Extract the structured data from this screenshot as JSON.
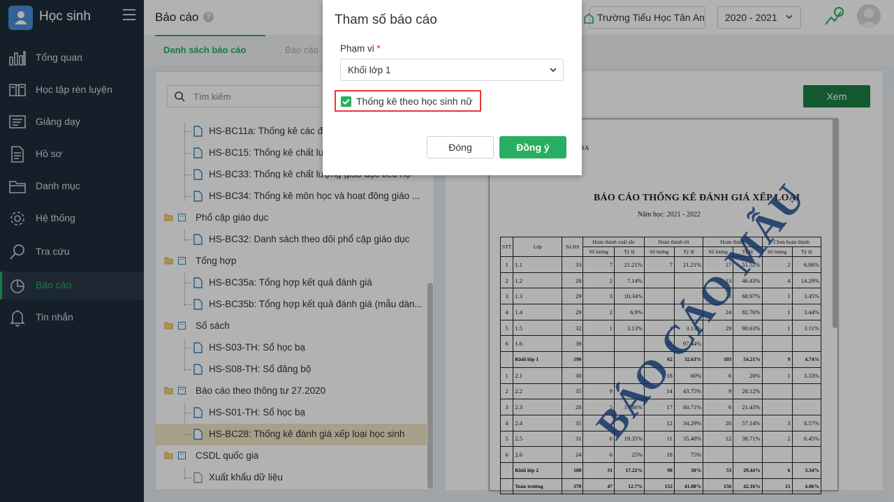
{
  "app": {
    "title": "Học sinh"
  },
  "sidebar": {
    "items": [
      {
        "label": "Tổng quan",
        "icon": "bar-chart-icon"
      },
      {
        "label": "Học tập rèn luyện",
        "icon": "book-icon"
      },
      {
        "label": "Giảng dạy",
        "icon": "board-icon"
      },
      {
        "label": "Hồ sơ",
        "icon": "document-icon"
      },
      {
        "label": "Danh mục",
        "icon": "folder-icon"
      },
      {
        "label": "Hệ thống",
        "icon": "gear-icon"
      },
      {
        "label": "Tra cứu",
        "icon": "search-icon"
      },
      {
        "label": "Báo cáo",
        "icon": "pie-chart-icon",
        "active": true
      },
      {
        "label": "Tin nhắn",
        "icon": "bell-icon"
      }
    ]
  },
  "header": {
    "page_title": "Báo cáo",
    "help": "?",
    "school": "Trường Tiểu Học Tân An",
    "year": "2020 - 2021"
  },
  "tabs": {
    "list": "Danh sách báo cáo",
    "other": "Báo cáo"
  },
  "search": {
    "placeholder": "Tìm kiếm"
  },
  "tree": [
    {
      "type": "file",
      "label": "HS-BC11a: Thống kê các đố"
    },
    {
      "type": "file",
      "label": "HS-BC15: Thống kê chất lượ"
    },
    {
      "type": "file",
      "label": "HS-BC33: Thống kê chất lượng giáo dục tiểu học"
    },
    {
      "type": "file",
      "label": "HS-BC34: Thống kê môn học và hoạt động giáo ..."
    },
    {
      "type": "folder",
      "label": "Phổ cập giáo dục"
    },
    {
      "type": "file",
      "label": "HS-BC32: Danh sách theo dõi phổ cập giáo dục"
    },
    {
      "type": "folder",
      "label": "Tổng hợp"
    },
    {
      "type": "file",
      "label": "HS-BC35a: Tổng hợp kết quả đánh giá"
    },
    {
      "type": "file",
      "label": "HS-BC35b: Tổng hợp kết quả đánh giá (mẫu dàn..."
    },
    {
      "type": "folder",
      "label": "Sổ sách"
    },
    {
      "type": "file",
      "label": "HS-S03-TH: Sổ học bạ"
    },
    {
      "type": "file",
      "label": "HS-S08-TH: Sổ đăng bộ"
    },
    {
      "type": "folder",
      "label": "Báo cáo theo thông tư 27.2020"
    },
    {
      "type": "file",
      "label": "HS-S01-TH: Sổ học bạ"
    },
    {
      "type": "file",
      "label": "HS-BC28: Thống kê đánh giá xếp loại học sinh",
      "selected": true
    },
    {
      "type": "folder",
      "label": "CSDL quốc gia"
    },
    {
      "type": "file",
      "label": "Xuất khẩu dữ liệu"
    }
  ],
  "view_button": "Xem",
  "preview": {
    "corner": "SA",
    "title": "BÁO CÁO THỐNG KÊ ĐÁNH GIÁ XẾP LOẠI",
    "subtitle": "Năm học: 2021 - 2022",
    "watermark": "BÁO CÁO MẪU",
    "headers": [
      "STT",
      "Lớp",
      "Số HS",
      "Hoàn thành xuất sắc",
      "Hoàn thành tốt",
      "Hoàn thành",
      "Chưa hoàn thành"
    ],
    "subheaders": [
      "Số lượng",
      "Tỷ lệ",
      "Số lượng",
      "Tỷ lệ",
      "Số lượng",
      "Tỷ lệ",
      "Số lượng",
      "Tỷ lệ"
    ],
    "rows": [
      [
        "1",
        "1.1",
        "33",
        "7",
        "21.21%",
        "7",
        "21.21%",
        "17",
        "51.52%",
        "2",
        "6.06%"
      ],
      [
        "2",
        "1.2",
        "28",
        "2",
        "7.14%",
        "",
        "",
        "13",
        "46.43%",
        "4",
        "14.29%"
      ],
      [
        "3",
        "1.3",
        "29",
        "3",
        "10.34%",
        "",
        "",
        "20",
        "68.97%",
        "1",
        "3.45%"
      ],
      [
        "4",
        "1.4",
        "29",
        "2",
        "6.9%",
        "",
        "",
        "24",
        "82.76%",
        "1",
        "3.44%"
      ],
      [
        "5",
        "1.5",
        "32",
        "1",
        "3.13%",
        "1",
        "3.13%",
        "29",
        "90.63%",
        "1",
        "3.11%"
      ],
      [
        "6",
        "1.6",
        "39",
        "",
        "",
        "38",
        "97.44%",
        "",
        "",
        "",
        ""
      ],
      [
        "",
        "Khối lớp 1",
        "190",
        "",
        "",
        "62",
        "32.63%",
        "103",
        "54.21%",
        "9",
        "4.74%"
      ],
      [
        "1",
        "2.1",
        "30",
        "",
        "",
        "18",
        "60%",
        "6",
        "20%",
        "1",
        "3.33%"
      ],
      [
        "2",
        "2.2",
        "35",
        "9",
        "",
        "14",
        "43.75%",
        "9",
        "28.12%",
        "",
        ""
      ],
      [
        "3",
        "2.3",
        "28",
        "5",
        "17.86%",
        "17",
        "60.71%",
        "6",
        "21.43%",
        "",
        ""
      ],
      [
        "4",
        "2.4",
        "35",
        "",
        "",
        "12",
        "34.29%",
        "20",
        "57.14%",
        "3",
        "8.57%"
      ],
      [
        "5",
        "2.5",
        "31",
        "6",
        "19.35%",
        "11",
        "35.48%",
        "12",
        "38.71%",
        "2",
        "6.45%"
      ],
      [
        "6",
        "2.6",
        "24",
        "6",
        "25%",
        "18",
        "75%",
        "",
        "",
        "",
        ""
      ],
      [
        "",
        "Khối lớp 2",
        "180",
        "31",
        "17.22%",
        "90",
        "50%",
        "53",
        "29.44%",
        "6",
        "3.34%"
      ],
      [
        "",
        "Toàn trường",
        "370",
        "47",
        "12.7%",
        "152",
        "41.08%",
        "156",
        "42.16%",
        "15",
        "4.06%"
      ]
    ]
  },
  "modal": {
    "title": "Tham số báo cáo",
    "field_label": "Phạm vi",
    "required": "*",
    "scope_value": "Khối lớp 1",
    "checkbox_label": "Thống kê theo học sinh nữ",
    "checkbox_checked": true,
    "close_label": "Đóng",
    "ok_label": "Đồng ý"
  }
}
